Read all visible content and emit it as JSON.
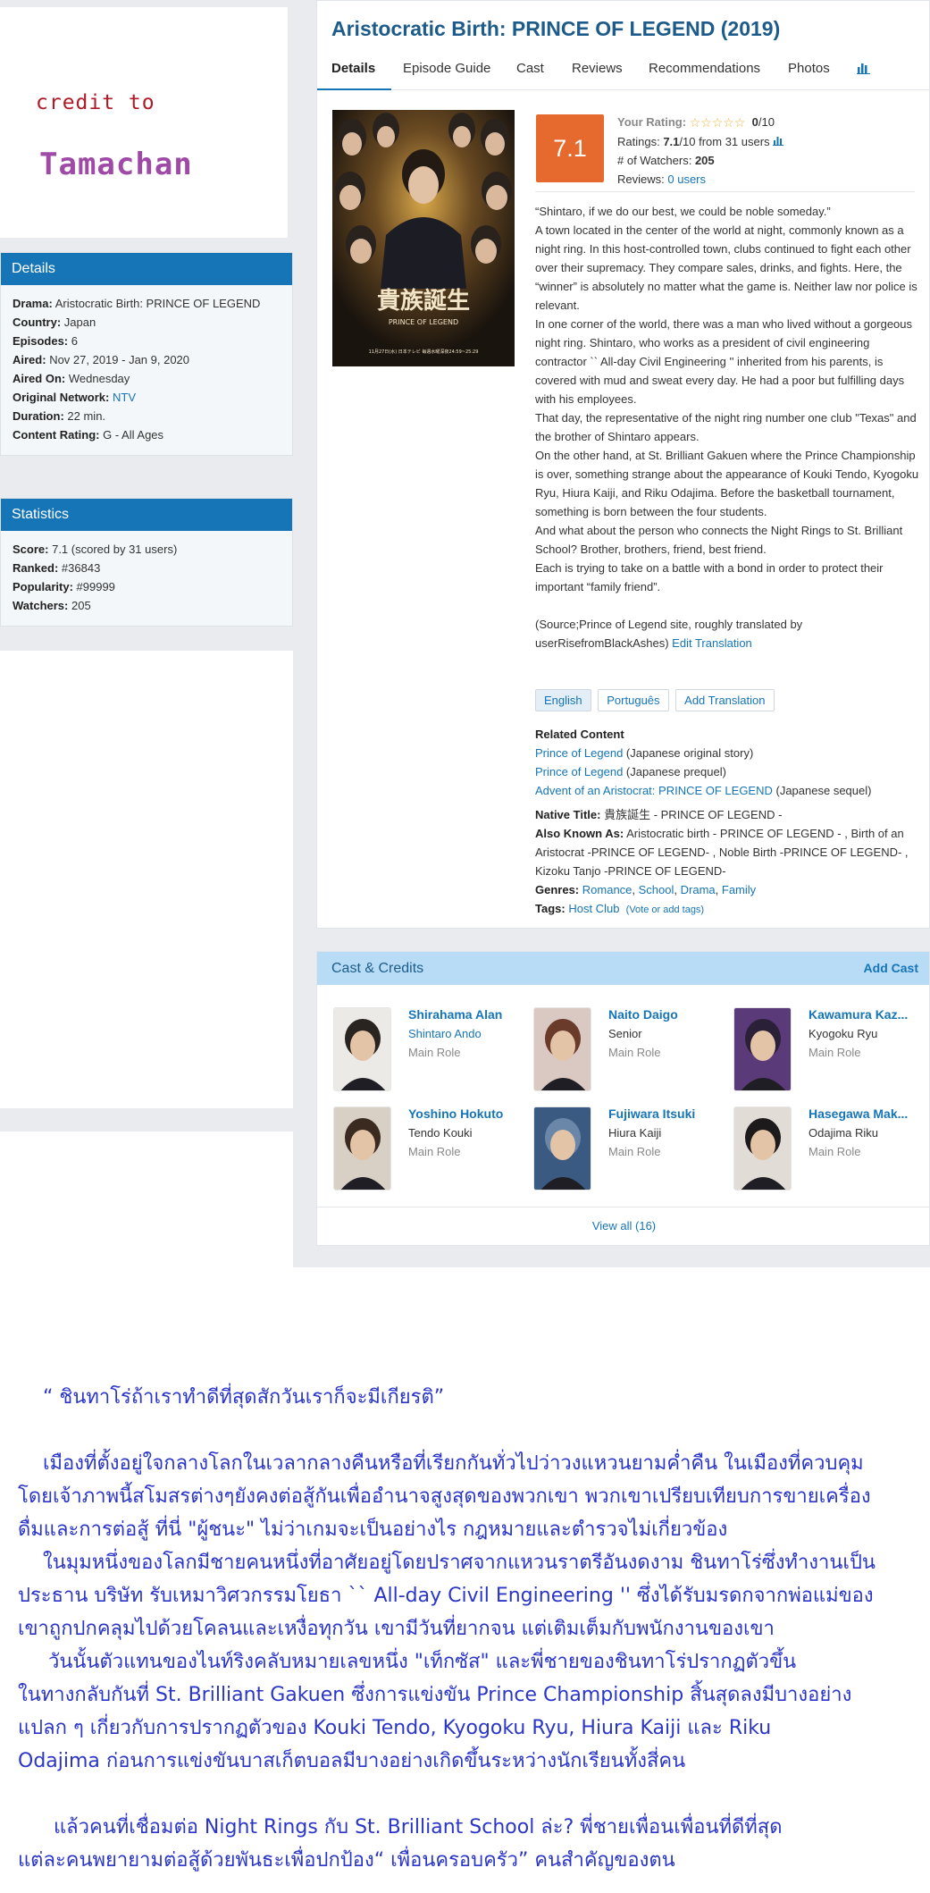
{
  "credit": {
    "line1": "credit to",
    "line2": "Tamachan"
  },
  "details": {
    "header": "Details",
    "rows": [
      {
        "label": "Drama:",
        "value": "Aristocratic Birth: PRINCE OF LEGEND"
      },
      {
        "label": "Country:",
        "value": "Japan"
      },
      {
        "label": "Episodes:",
        "value": "6"
      },
      {
        "label": "Aired:",
        "value": "Nov 27, 2019 - Jan 9, 2020"
      },
      {
        "label": "Aired On:",
        "value": "Wednesday"
      },
      {
        "label": "Original Network:",
        "value": "NTV"
      },
      {
        "label": "Duration:",
        "value": "22 min."
      },
      {
        "label": "Content Rating:",
        "value": "G - All Ages"
      }
    ]
  },
  "statistics": {
    "header": "Statistics",
    "rows": [
      {
        "label": "Score:",
        "value": "7.1 (scored by 31 users)"
      },
      {
        "label": "Ranked:",
        "value": "#36843"
      },
      {
        "label": "Popularity:",
        "value": "#99999"
      },
      {
        "label": "Watchers:",
        "value": "205"
      }
    ]
  },
  "main": {
    "title": "Aristocratic Birth: PRINCE OF LEGEND (2019)",
    "tabs": [
      "Details",
      "Episode Guide",
      "Cast",
      "Reviews",
      "Recommendations",
      "Photos"
    ],
    "chart_icon": "bar-chart-icon",
    "poster": {
      "title_jp": "貴族誕生",
      "subtitle": "PRINCE OF LEGEND",
      "tagline": "11月27日(水) 日本テレビ 毎週水曜深夜24:59~25:29"
    },
    "score": "7.1",
    "rating": {
      "your_rating_label": "Your Rating:",
      "your_rating_value": "0",
      "your_rating_max": "/10",
      "ratings_label": "Ratings:",
      "ratings_value": "7.1",
      "ratings_suffix": "/10 from 31 users",
      "watchers_label": "# of Watchers:",
      "watchers_value": "205",
      "reviews_label": "Reviews:",
      "reviews_value": "0 users"
    },
    "synopsis": [
      "“Shintaro, if we do our best, we could be noble someday.”",
      "A town located in the center of the world at night, commonly known as a night ring. In this host-controlled town, clubs continued to fight each other over their supremacy. They compare sales, drinks, and fights. Here, the “winner” is absolutely no matter what the game is. Neither law nor police is relevant.",
      "In one corner of the world, there was a man who lived without a gorgeous night ring. Shintaro, who works as a president of civil engineering contractor `` All-day Civil Engineering '' inherited from his parents, is covered with mud and sweat every day. He had a poor but fulfilling days with his employees.",
      "That day, the representative of the night ring number one club \"Texas\" and the brother of Shintaro appears.",
      "On the other hand, at St. Brilliant Gakuen where the Prince Championship is over, something strange about the appearance of Kouki Tendo, Kyogoku Ryu, Hiura Kaiji, and Riku Odajima. Before the basketball tournament, something is born between the four students.",
      "And what about the person who connects the Night Rings to St. Brilliant School? Brother, brothers, friend, best friend.",
      "Each is trying to take on a battle with a bond in order to protect their important “family friend”."
    ],
    "source_text": "(Source;Prince of Legend site, roughly translated by userRisefromBlackAshes)",
    "edit_translation": "Edit Translation",
    "languages": [
      "English",
      "Português",
      "Add Translation"
    ],
    "related": {
      "header": "Related Content",
      "items": [
        {
          "title": "Prince of Legend",
          "note": "(Japanese original story)"
        },
        {
          "title": "Prince of Legend",
          "note": "(Japanese prequel)"
        },
        {
          "title": "Advent of an Aristocrat: PRINCE OF LEGEND",
          "note": "(Japanese sequel)"
        }
      ]
    },
    "native_title_label": "Native Title:",
    "native_title": "貴族誕生 - PRINCE OF LEGEND -",
    "aka_label": "Also Known As:",
    "aka": "Aristocratic birth - PRINCE OF LEGEND - , Birth of an Aristocrat -PRINCE OF LEGEND- , Noble Birth -PRINCE OF LEGEND- , Kizoku Tanjo -PRINCE OF LEGEND-",
    "genres_label": "Genres:",
    "genres": [
      "Romance",
      "School",
      "Drama",
      "Family"
    ],
    "tags_label": "Tags:",
    "tags": [
      "Host Club"
    ],
    "tags_vote": "(Vote or add tags)"
  },
  "cast": {
    "header": "Cast & Credits",
    "add_label": "Add Cast",
    "members": [
      {
        "name": "Shirahama Alan",
        "character": "Shintaro Ando",
        "role": "Main Role",
        "char_link": true,
        "hair": "#2a2420",
        "bg": "#eceae6"
      },
      {
        "name": "Naito Daigo",
        "character": "Senior",
        "role": "Main Role",
        "char_link": false,
        "hair": "#6a3a2a",
        "bg": "#d9c9c2"
      },
      {
        "name": "Kawamura Kaz...",
        "character": "Kyogoku Ryu",
        "role": "Main Role",
        "char_link": false,
        "hair": "#2a2038",
        "bg": "#5a3a78"
      },
      {
        "name": "Yoshino Hokuto",
        "character": "Tendo Kouki",
        "role": "Main Role",
        "char_link": false,
        "hair": "#3a2a20",
        "bg": "#d8cfc5"
      },
      {
        "name": "Fujiwara Itsuki",
        "character": "Hiura Kaiji",
        "role": "Main Role",
        "char_link": false,
        "hair": "#6a86a8",
        "bg": "#3a5a82"
      },
      {
        "name": "Hasegawa Mak...",
        "character": "Odajima Riku",
        "role": "Main Role",
        "char_link": false,
        "hair": "#1c1a1a",
        "bg": "#e2dcd6"
      }
    ],
    "view_all": "View all (16)"
  },
  "thai_text": [
    "“ ชินทาโร่ถ้าเราทำดีที่สุดสักวันเราก็จะมีเกียรติ”",
    "",
    "เมืองที่ตั้งอยู่ใจกลางโลกในเวลากลางคืนหรือที่เรียกกันทั่วไปว่าวงแหวนยามค่ำคืน ในเมืองที่ควบคุม",
    "โดยเจ้าภาพนี้สโมสรต่างๆยังคงต่อสู้กันเพื่ออำนาจสูงสุดของพวกเขา พวกเขาเปรียบเทียบการขายเครื่อง",
    "ดื่มและการต่อสู้ ที่นี่ \"ผู้ชนะ\" ไม่ว่าเกมจะเป็นอย่างไร กฎหมายและตำรวจไม่เกี่ยวข้อง",
    "ในมุมหนึ่งของโลกมีชายคนหนึ่งที่อาศัยอยู่โดยปราศจากแหวนราตรีอันงดงาม ชินทาโร่ซึ่งทำงานเป็น",
    "ประธาน บริษัท รับเหมาวิศวกรรมโยธา `` All-day Civil Engineering '' ซึ่งได้รับมรดกจากพ่อแม่ของ",
    "เขาถูกปกคลุมไปด้วยโคลนและเหงื่อทุกวัน เขามีวันที่ยากจน แต่เติมเต็มกับพนักงานของเขา",
    "วันนั้นตัวแทนของไนท์ริงคลับหมายเลขหนึ่ง \"เท็กซัส\" และพี่ชายของชินทาโร่ปรากฏตัวขึ้น",
    "ในทางกลับกันที่ St. Brilliant Gakuen ซึ่งการแข่งขัน Prince Championship สิ้นสุดลงมีบางอย่าง",
    "แปลก ๆ เกี่ยวกับการปรากฏตัวของ Kouki Tendo, Kyogoku Ryu, Hiura Kaiji และ Riku",
    "Odajima ก่อนการแข่งขันบาสเก็ตบอลมีบางอย่างเกิดขึ้นระหว่างนักเรียนทั้งสี่คน",
    "",
    "แล้วคนที่เชื่อมต่อ Night Rings กับ St. Brilliant School ล่ะ? พี่ชายเพื่อนเพื่อนที่ดีที่สุด",
    "แต่ละคนพยายามต่อสู้ด้วยพันธะเพื่อปกป้อง“ เพื่อนครอบครัว” คนสำคัญของตน"
  ],
  "colors": {
    "brand_blue": "#1675b6",
    "score_orange": "#e66a2e",
    "thai_text": "#2b36c8",
    "credit_red": "#b01a28",
    "credit_purple": "#a04aa8"
  }
}
